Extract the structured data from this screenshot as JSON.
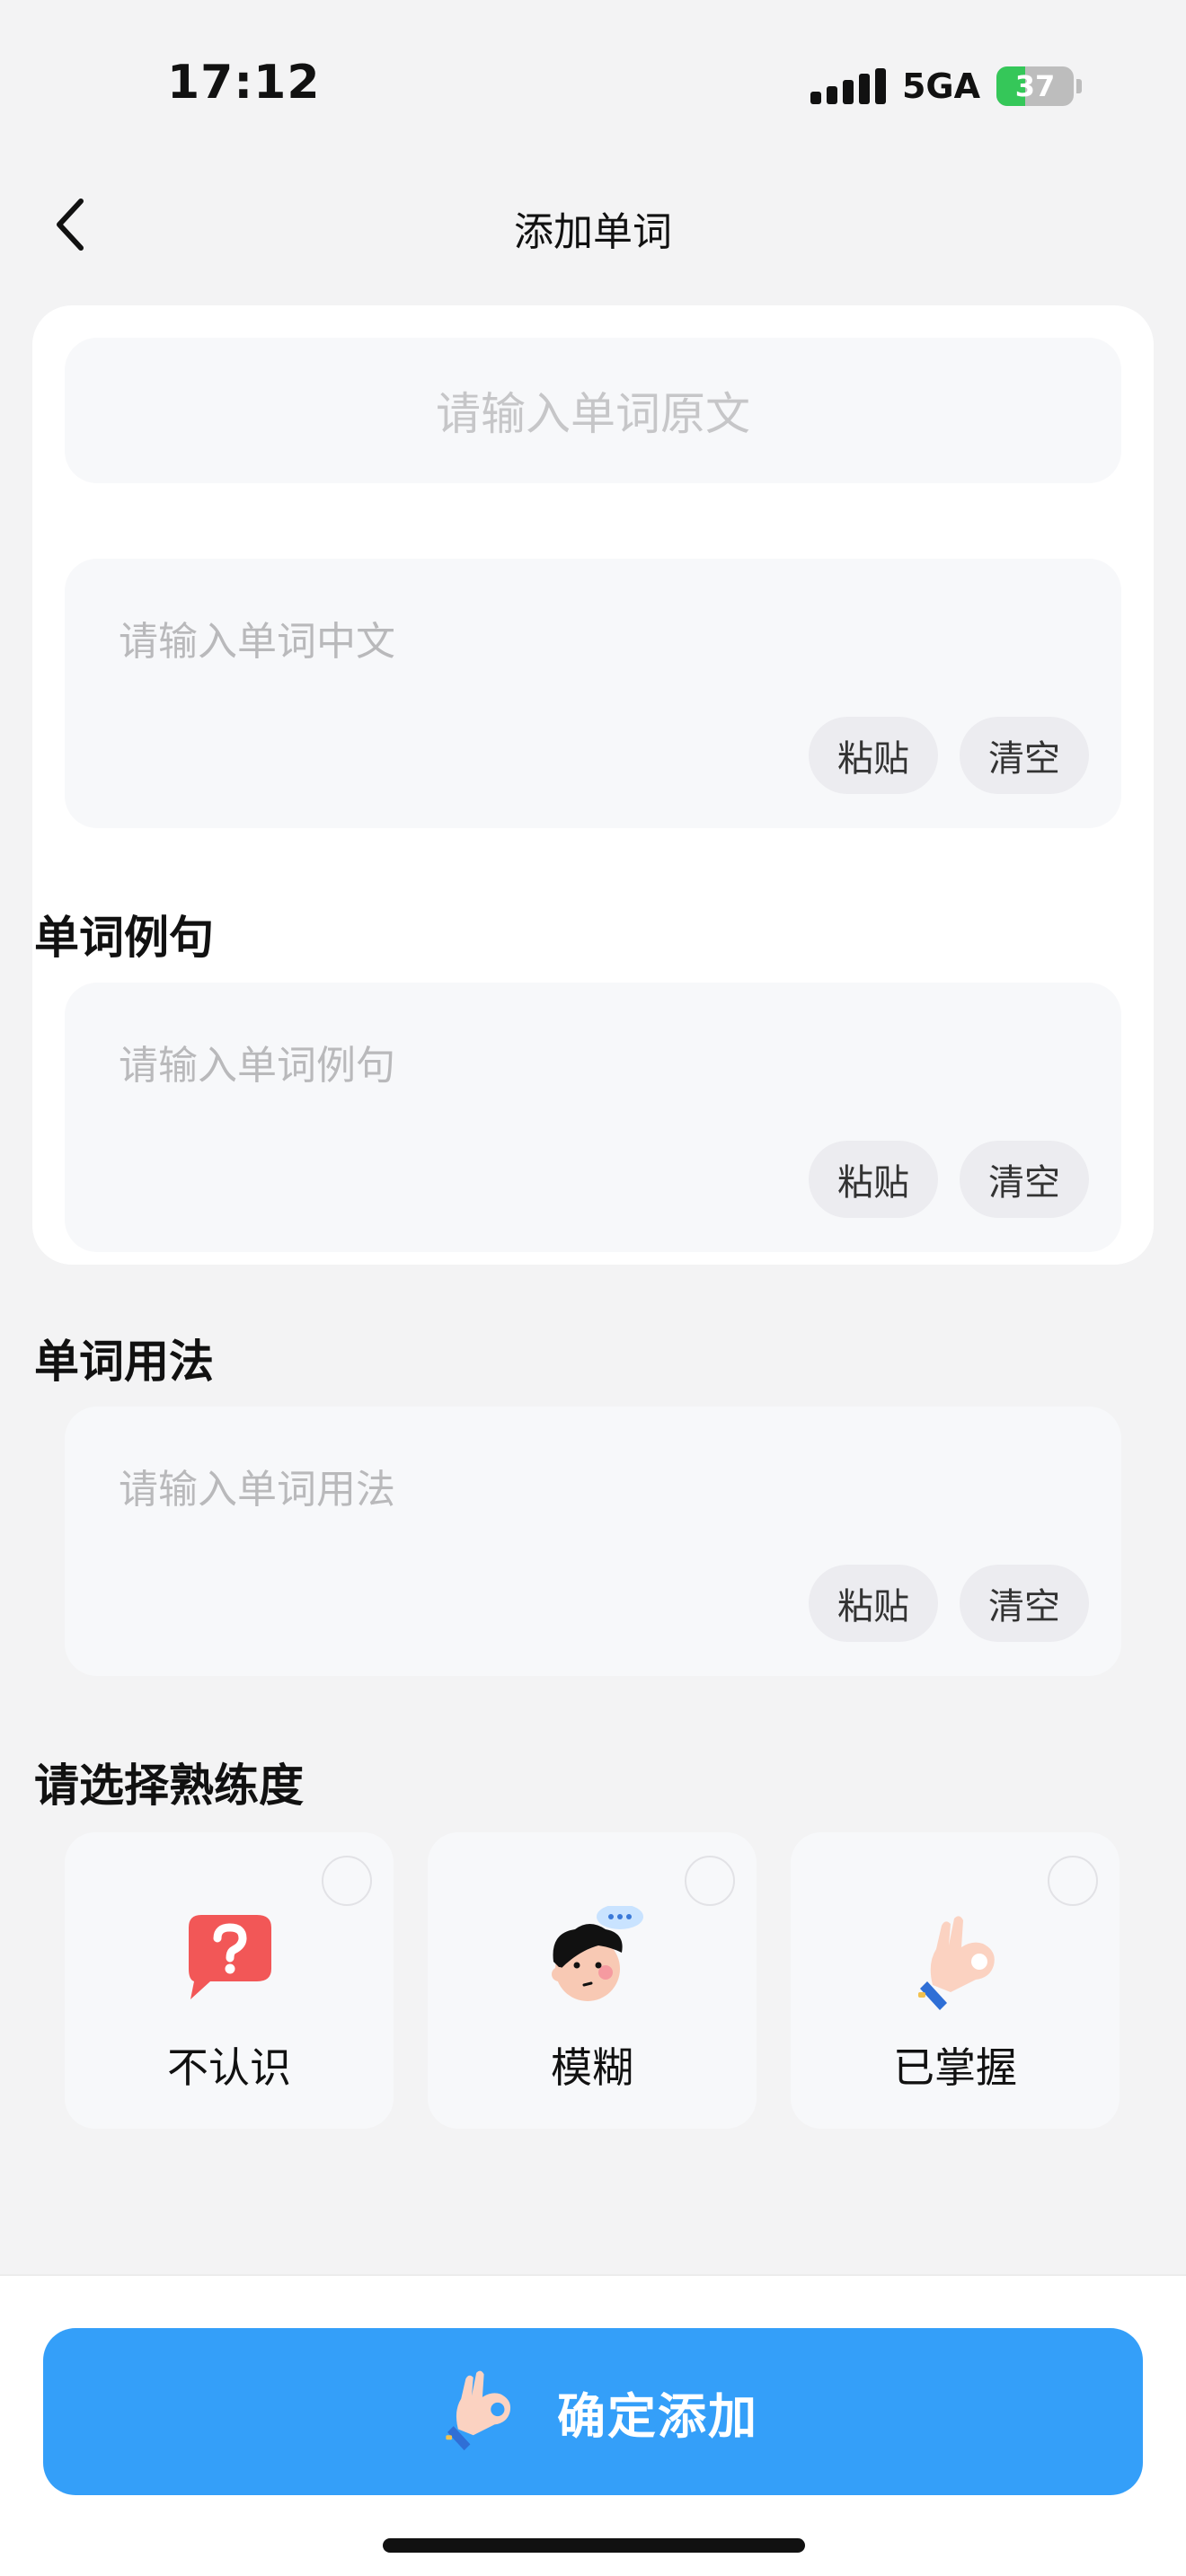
{
  "status_bar": {
    "time": "17:12",
    "network": "5GA",
    "battery_percent": "37",
    "battery_level": 0.37
  },
  "nav": {
    "title": "添加单词",
    "back_icon": "chevron-left-icon"
  },
  "form": {
    "word": {
      "placeholder": "请输入单词原文"
    },
    "chinese": {
      "placeholder": "请输入单词中文",
      "paste_label": "粘贴",
      "clear_label": "清空"
    },
    "example": {
      "section_title": "单词例句",
      "placeholder": "请输入单词例句",
      "paste_label": "粘贴",
      "clear_label": "清空"
    },
    "usage": {
      "section_title": "单词用法",
      "placeholder": "请输入单词用法",
      "paste_label": "粘贴",
      "clear_label": "清空"
    }
  },
  "proficiency": {
    "section_title": "请选择熟练度",
    "options": [
      {
        "label": "不认识",
        "icon": "question-bubble-icon",
        "selected": false
      },
      {
        "label": "模糊",
        "icon": "confused-face-icon",
        "selected": false
      },
      {
        "label": "已掌握",
        "icon": "ok-hand-icon",
        "selected": false
      }
    ]
  },
  "confirm": {
    "label": "确定添加",
    "icon": "ok-hand-icon"
  },
  "colors": {
    "accent": "#349ff9",
    "background": "#f3f3f4",
    "field": "#f7f8fa",
    "battery_fill": "#35c759"
  }
}
